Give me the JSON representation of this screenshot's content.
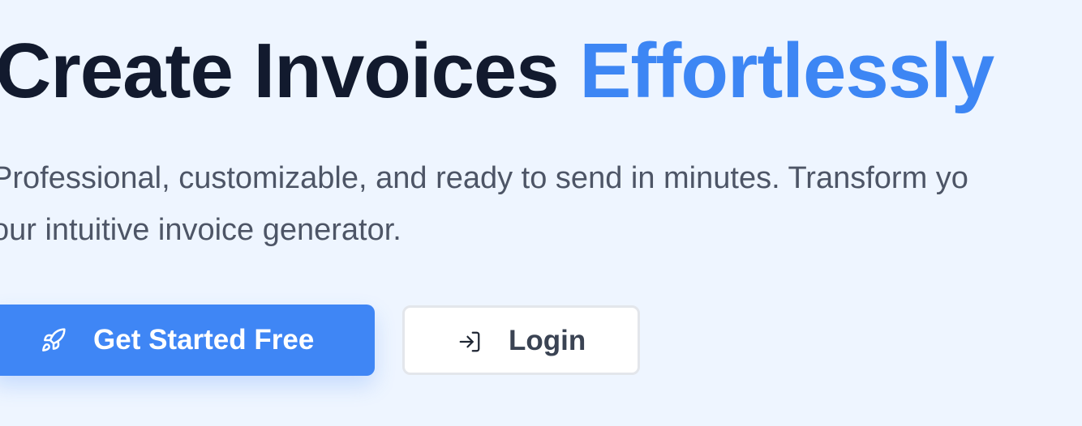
{
  "hero": {
    "title_main": "Create Invoices",
    "title_accent": "Effortlessly",
    "subtitle_line1": "Professional, customizable, and ready to send in minutes. Transform yo",
    "subtitle_line2": "our intuitive invoice generator."
  },
  "buttons": {
    "get_started": {
      "label": "Get Started Free",
      "icon": "rocket-icon"
    },
    "login": {
      "label": "Login",
      "icon": "login-icon"
    }
  },
  "colors": {
    "background": "#eef5ff",
    "heading": "#121a2e",
    "accent": "#3d86f4",
    "subtitle": "#4d5566",
    "primary_button": "#3f86f5",
    "secondary_text": "#3a4353"
  }
}
